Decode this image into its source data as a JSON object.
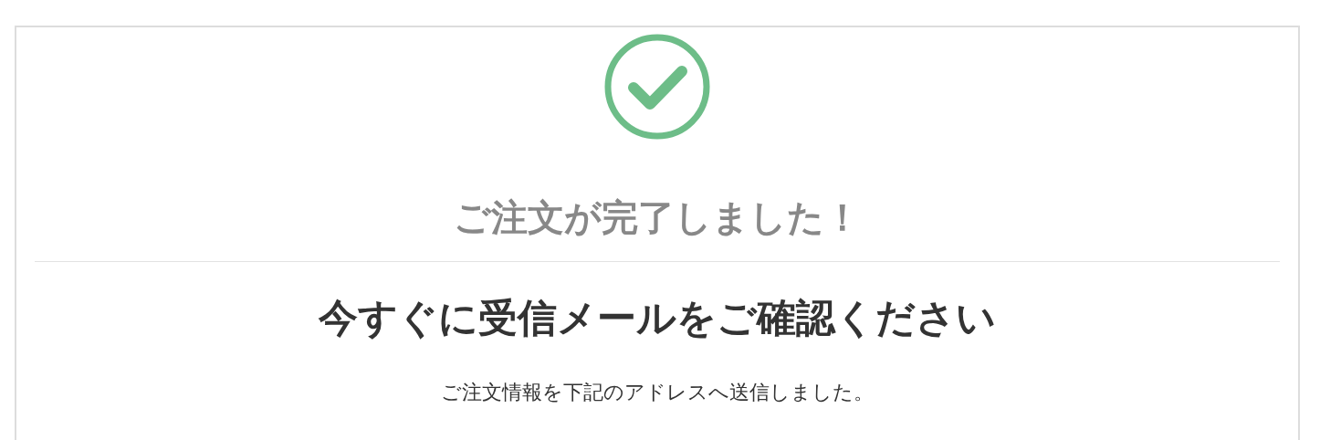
{
  "title": "ご注文が完了しました！",
  "heading": "今すぐに受信メールをご確認ください",
  "message": "ご注文情報を下記のアドレスへ送信しました。"
}
